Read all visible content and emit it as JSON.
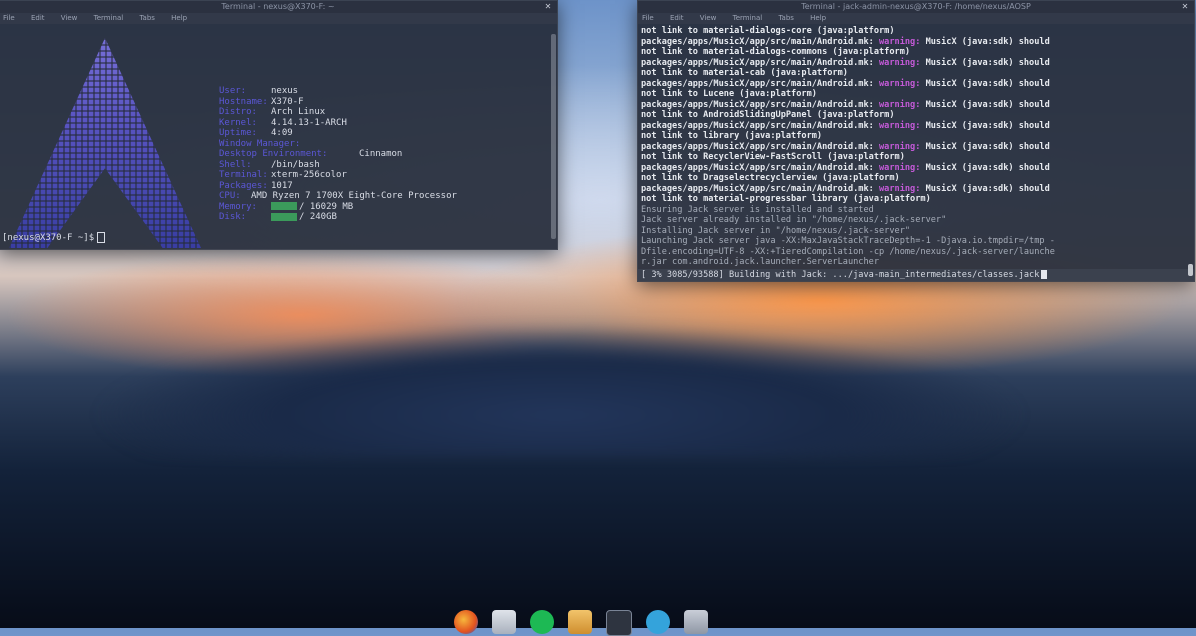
{
  "left_terminal": {
    "title": "Terminal - nexus@X370-F: ~",
    "menu": [
      "File",
      "Edit",
      "View",
      "Terminal",
      "Tabs",
      "Help"
    ],
    "info": [
      {
        "key": "User:",
        "value": "nexus"
      },
      {
        "key": "Hostname:",
        "value": "X370-F"
      },
      {
        "key": "Distro:",
        "value": "Arch Linux"
      },
      {
        "key": "Kernel:",
        "value": "4.14.13-1-ARCH"
      },
      {
        "key": "Uptime:",
        "value": "4:09"
      },
      {
        "key": "Window Manager:",
        "value": ""
      },
      {
        "key": "Desktop Environment:",
        "value": "Cinnamon"
      },
      {
        "key": "Shell:",
        "value": "/bin/bash"
      },
      {
        "key": "Terminal:",
        "value": "xterm-256color"
      },
      {
        "key": "Packages:",
        "value": "1017"
      },
      {
        "key": "CPU:",
        "value": "AMD Ryzen 7 1700X Eight-Core Processor"
      },
      {
        "key": "Memory:",
        "value": "/ 16029 MB"
      },
      {
        "key": "Disk:",
        "value": "/ 240GB"
      }
    ],
    "prompt": "[nexus@X370-F ~]$"
  },
  "right_terminal": {
    "title": "Terminal - jack-admin-nexus@X370-F: /home/nexus/AOSP",
    "menu": [
      "File",
      "Edit",
      "View",
      "Terminal",
      "Tabs",
      "Help"
    ],
    "lines": [
      {
        "text": "not link to material-dialogs-core (java:platform)",
        "warn": ""
      },
      {
        "text": "packages/apps/MusicX/app/src/main/Android.mk: ",
        "warn": "warning:",
        "tail": " MusicX (java:sdk) should"
      },
      {
        "text": "not link to material-dialogs-commons (java:platform)",
        "warn": ""
      },
      {
        "text": "packages/apps/MusicX/app/src/main/Android.mk: ",
        "warn": "warning:",
        "tail": " MusicX (java:sdk) should"
      },
      {
        "text": "not link to material-cab (java:platform)",
        "warn": ""
      },
      {
        "text": "packages/apps/MusicX/app/src/main/Android.mk: ",
        "warn": "warning:",
        "tail": " MusicX (java:sdk) should"
      },
      {
        "text": "not link to Lucene (java:platform)",
        "warn": ""
      },
      {
        "text": "packages/apps/MusicX/app/src/main/Android.mk: ",
        "warn": "warning:",
        "tail": " MusicX (java:sdk) should"
      },
      {
        "text": "not link to AndroidSlidingUpPanel (java:platform)",
        "warn": ""
      },
      {
        "text": "packages/apps/MusicX/app/src/main/Android.mk: ",
        "warn": "warning:",
        "tail": " MusicX (java:sdk) should"
      },
      {
        "text": "not link to library (java:platform)",
        "warn": ""
      },
      {
        "text": "packages/apps/MusicX/app/src/main/Android.mk: ",
        "warn": "warning:",
        "tail": " MusicX (java:sdk) should"
      },
      {
        "text": "not link to RecyclerView-FastScroll (java:platform)",
        "warn": ""
      },
      {
        "text": "packages/apps/MusicX/app/src/main/Android.mk: ",
        "warn": "warning:",
        "tail": " MusicX (java:sdk) should"
      },
      {
        "text": "not link to Dragselectrecyclerview (java:platform)",
        "warn": ""
      },
      {
        "text": "packages/apps/MusicX/app/src/main/Android.mk: ",
        "warn": "warning:",
        "tail": " MusicX (java:sdk) should"
      },
      {
        "text": "not link to material-progressbar library (java:platform)",
        "warn": ""
      },
      {
        "text": "Ensuring Jack server is installed and started",
        "warn": "",
        "dim": true
      },
      {
        "text": "Jack server already installed in \"/home/nexus/.jack-server\"",
        "warn": "",
        "dim": true
      },
      {
        "text": "Installing Jack server in \"/home/nexus/.jack-server\"",
        "warn": "",
        "dim": true
      },
      {
        "text": "Launching Jack server java -XX:MaxJavaStackTraceDepth=-1 -Djava.io.tmpdir=/tmp -",
        "warn": "",
        "dim": true
      },
      {
        "text": "Dfile.encoding=UTF-8 -XX:+TieredCompilation -cp /home/nexus/.jack-server/launche",
        "warn": "",
        "dim": true
      },
      {
        "text": "r.jar com.android.jack.launcher.ServerLauncher",
        "warn": "",
        "dim": true
      }
    ],
    "status": "[  3% 3085/93588] Building with Jack: .../java-main_intermediates/classes.jack"
  },
  "dock": {
    "icons": [
      "firefox-icon",
      "files-icon",
      "spotify-icon",
      "archive-icon",
      "terminal-icon",
      "telegram-icon",
      "trash-icon"
    ]
  },
  "colors": {
    "prompt_key": "#5b57d6",
    "warning": "#c45ad8",
    "terminal_bg": "#262c3a"
  }
}
